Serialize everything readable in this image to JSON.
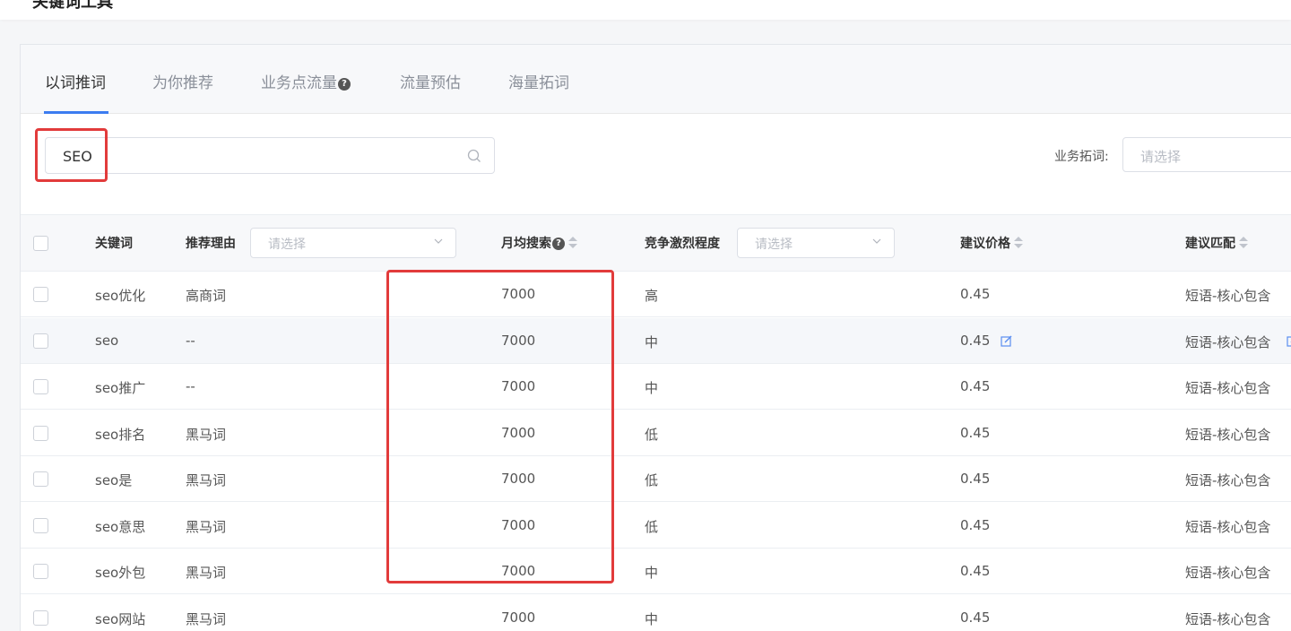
{
  "page": {
    "title": "关键词工具"
  },
  "tabs": [
    {
      "label": "以词推词",
      "active": true
    },
    {
      "label": "为你推荐",
      "active": false
    },
    {
      "label": "业务点流量",
      "active": false,
      "help": "?"
    },
    {
      "label": "流量预估",
      "active": false
    },
    {
      "label": "海量拓词",
      "active": false
    }
  ],
  "search": {
    "value": "SEO",
    "icon": "search-icon"
  },
  "biz_expand": {
    "label": "业务拓词:",
    "placeholder": "请选择"
  },
  "table": {
    "headers": {
      "keyword": "关键词",
      "reason": "推荐理由",
      "reason_placeholder": "请选择",
      "monthly_search": "月均搜索",
      "monthly_help": "?",
      "competition": "竞争激烈程度",
      "competition_placeholder": "请选择",
      "price": "建议价格",
      "match": "建议匹配"
    },
    "rows": [
      {
        "keyword": "seo优化",
        "reason": "高商词",
        "monthly": "7000",
        "competition": "高",
        "price": "0.45",
        "match": "短语-核心包含"
      },
      {
        "keyword": "seo",
        "reason": "--",
        "monthly": "7000",
        "competition": "中",
        "price": "0.45",
        "match": "短语-核心包含"
      },
      {
        "keyword": "seo推广",
        "reason": "--",
        "monthly": "7000",
        "competition": "中",
        "price": "0.45",
        "match": "短语-核心包含"
      },
      {
        "keyword": "seo排名",
        "reason": "黑马词",
        "monthly": "7000",
        "competition": "低",
        "price": "0.45",
        "match": "短语-核心包含"
      },
      {
        "keyword": "seo是",
        "reason": "黑马词",
        "monthly": "7000",
        "competition": "低",
        "price": "0.45",
        "match": "短语-核心包含"
      },
      {
        "keyword": "seo意思",
        "reason": "黑马词",
        "monthly": "7000",
        "competition": "低",
        "price": "0.45",
        "match": "短语-核心包含"
      },
      {
        "keyword": "seo外包",
        "reason": "黑马词",
        "monthly": "7000",
        "competition": "中",
        "price": "0.45",
        "match": "短语-核心包含"
      },
      {
        "keyword": "seo网站",
        "reason": "黑马词",
        "monthly": "7000",
        "competition": "中",
        "price": "0.45",
        "match": "短语-核心包含"
      }
    ]
  },
  "colors": {
    "accent": "#3c7cf0",
    "highlight": "#e23b3b"
  }
}
